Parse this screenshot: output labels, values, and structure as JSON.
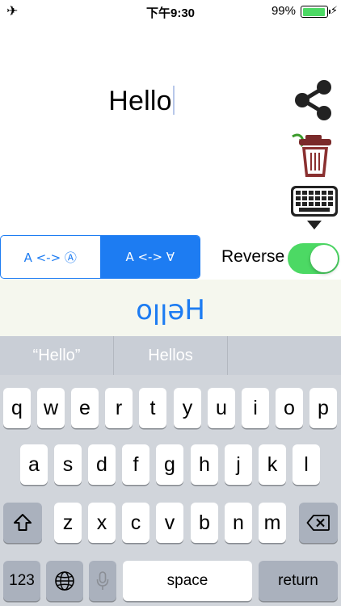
{
  "status_bar": {
    "time": "下午9:30",
    "battery_percent": "99%",
    "battery_level": 0.99
  },
  "editor": {
    "text": "Hello"
  },
  "tools": {
    "share_icon": "share-icon",
    "trash_icon": "trash-icon",
    "keyboard_icon": "keyboard-hide-icon"
  },
  "mode": {
    "options": [
      "A <-> Ⓐ",
      "A <-> ∀"
    ],
    "selected_index": 1
  },
  "reverse": {
    "label": "Reverse",
    "on": true
  },
  "output": {
    "text": "oןןǝH"
  },
  "keyboard": {
    "suggestions": [
      "“Hello”",
      "Hellos",
      ""
    ],
    "row1": [
      "q",
      "w",
      "e",
      "r",
      "t",
      "y",
      "u",
      "i",
      "o",
      "p"
    ],
    "row2": [
      "a",
      "s",
      "d",
      "f",
      "g",
      "h",
      "j",
      "k",
      "l"
    ],
    "row3": [
      "z",
      "x",
      "c",
      "v",
      "b",
      "n",
      "m"
    ],
    "numbers_label": "123",
    "space_label": "space",
    "return_label": "return"
  },
  "colors": {
    "accent": "#1d7cf2",
    "switch_on": "#4cd964",
    "keyboard_bg": "#d1d5db",
    "special_key": "#aab1bd"
  }
}
